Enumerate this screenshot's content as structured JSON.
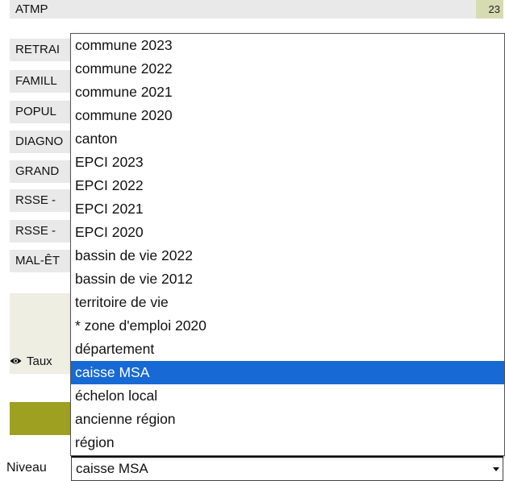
{
  "menu_rows": [
    {
      "label": "ATMP",
      "value": "23"
    },
    {
      "label": "RETRAI"
    },
    {
      "label": "FAMILL"
    },
    {
      "label": "POPUL"
    },
    {
      "label": "DIAGNO"
    },
    {
      "label": "GRAND"
    },
    {
      "label": "RSSE - "
    },
    {
      "label": "RSSE - "
    },
    {
      "label": "MAL-ÊT"
    }
  ],
  "info": {
    "label": "Taux",
    "icon": "eye-icon"
  },
  "niveau": {
    "label": "Niveau",
    "selected_value": "caisse MSA",
    "options": [
      "commune 2023",
      "commune 2022",
      "commune 2021",
      "commune 2020",
      "canton",
      "EPCI 2023",
      "EPCI 2022",
      "EPCI 2021",
      "EPCI 2020",
      "bassin de vie 2022",
      "bassin de vie 2012",
      "territoire de vie",
      "* zone d'emploi 2020",
      "département",
      "caisse MSA",
      "échelon local",
      "ancienne région",
      "région"
    ]
  },
  "colors": {
    "selected_option": "#1769d3",
    "olive_bar": "#9da021",
    "row_background": "#e9e9e9"
  }
}
